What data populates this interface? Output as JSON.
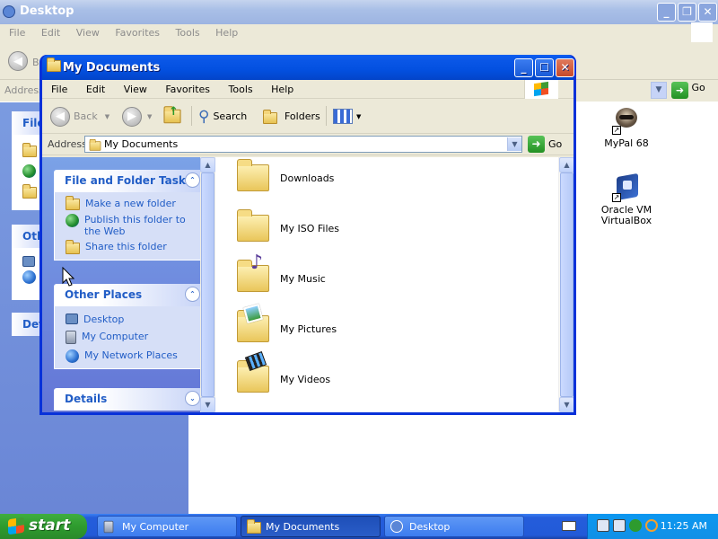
{
  "background_window": {
    "title": "Desktop",
    "menu": [
      "File",
      "Edit",
      "View",
      "Favorites",
      "Tools",
      "Help"
    ],
    "toolbar_back_initial": "B",
    "address_label": "Address",
    "go_label": "Go",
    "panels": [
      {
        "heading": "File"
      },
      {
        "heading": "Oth"
      },
      {
        "heading": "Det"
      }
    ],
    "controls": {
      "minimize": "_",
      "maximize": "❐",
      "close": "✕"
    }
  },
  "desktop_icons": [
    {
      "label": "MyPal 68",
      "icon": "mypal-raccoon-icon"
    },
    {
      "label": "Oracle VM VirtualBox",
      "icon": "virtualbox-icon"
    }
  ],
  "window": {
    "title": "My Documents",
    "controls": {
      "minimize": "_",
      "maximize": "☐",
      "close": "✕"
    },
    "menu": [
      "File",
      "Edit",
      "View",
      "Favorites",
      "Tools",
      "Help"
    ],
    "toolbar": {
      "back": "Back",
      "forward": "",
      "search": "Search",
      "folders": "Folders"
    },
    "address": {
      "label": "Address",
      "value": "My Documents",
      "go": "Go"
    },
    "task_pane": {
      "file_tasks": {
        "heading": "File and Folder Tasks",
        "links": [
          {
            "label": "Make a new folder",
            "icon": "new-folder-icon"
          },
          {
            "label": "Publish this folder to the Web",
            "icon": "publish-web-icon"
          },
          {
            "label": "Share this folder",
            "icon": "share-folder-icon"
          }
        ]
      },
      "other_places": {
        "heading": "Other Places",
        "links": [
          {
            "label": "Desktop",
            "icon": "desktop-icon"
          },
          {
            "label": "My Computer",
            "icon": "my-computer-icon"
          },
          {
            "label": "My Network Places",
            "icon": "network-places-icon"
          }
        ]
      },
      "details": {
        "heading": "Details"
      }
    },
    "files": [
      {
        "name": "Downloads",
        "icon": "folder-icon"
      },
      {
        "name": "My ISO Files",
        "icon": "folder-icon"
      },
      {
        "name": "My Music",
        "icon": "music-folder-icon"
      },
      {
        "name": "My Pictures",
        "icon": "pictures-folder-icon"
      },
      {
        "name": "My Videos",
        "icon": "videos-folder-icon"
      }
    ]
  },
  "taskbar": {
    "start": "start",
    "tasks": [
      {
        "label": "My Computer",
        "icon": "my-computer-icon",
        "active": false
      },
      {
        "label": "My Documents",
        "icon": "folder-icon",
        "active": true
      },
      {
        "label": "Desktop",
        "icon": "ie-icon",
        "active": false
      }
    ],
    "clock": "11:25 AM"
  },
  "colors": {
    "title_blue": "#0a5ef2",
    "window_frame": "#0831d9",
    "taskbar_blue": "#245ddb",
    "start_green": "#2e9b2e",
    "task_link_blue": "#215dc6",
    "chrome": "#ece9d8"
  }
}
